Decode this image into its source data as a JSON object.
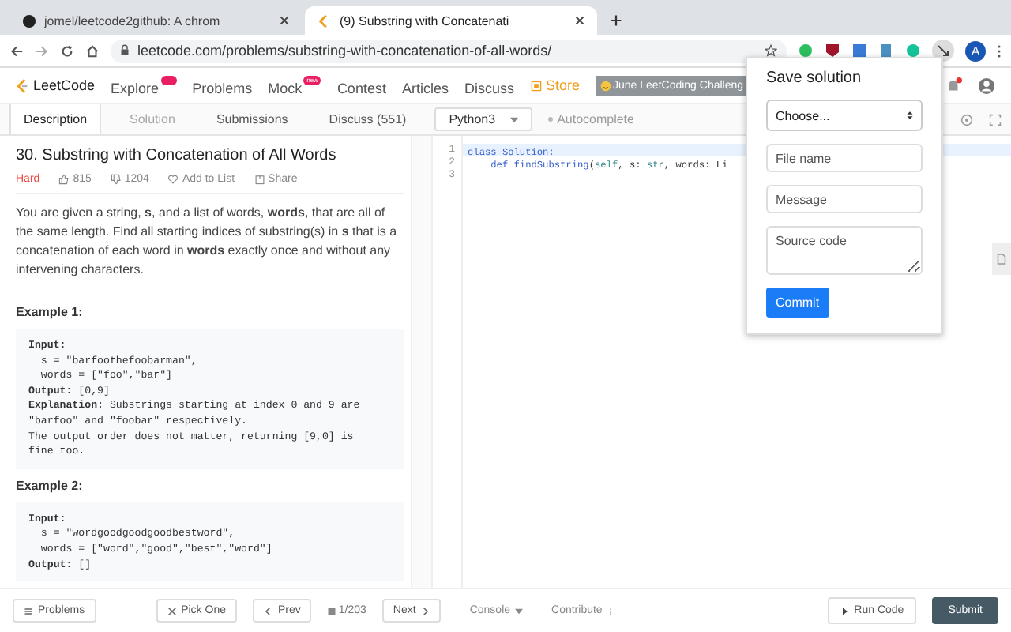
{
  "browser": {
    "tabs": [
      {
        "title": "jomel/leetcode2github: A chrom",
        "selected": false
      },
      {
        "title": "(9) Substring with Concatenati",
        "selected": true
      }
    ],
    "url": "leetcode.com/problems/substring-with-concatenation-of-all-words/",
    "profile": "A"
  },
  "nav": {
    "logo": "LeetCode",
    "items": [
      {
        "label": "Explore",
        "badge": true
      },
      {
        "label": "Problems",
        "badge": false
      },
      {
        "label": "Mock",
        "badge": true,
        "badge_text": "new"
      },
      {
        "label": "Contest",
        "badge": false
      },
      {
        "label": "Articles",
        "badge": false
      },
      {
        "label": "Discuss",
        "badge": false
      }
    ],
    "store": "Store",
    "banner": "June LeetCoding Challeng"
  },
  "subtabs": [
    {
      "label": "Description",
      "selected": true,
      "disabled": false
    },
    {
      "label": "Solution",
      "selected": false,
      "disabled": true
    },
    {
      "label": "Submissions",
      "selected": false,
      "disabled": false
    },
    {
      "label": "Discuss (551)",
      "selected": false,
      "disabled": false
    }
  ],
  "language": "Python3",
  "autocomplete": {
    "label": "Autocomplete",
    "on": false
  },
  "problem": {
    "title": "30. Substring with Concatenation of All Words",
    "difficulty": "Hard",
    "likes": "815",
    "dislikes": "1204",
    "add_to_list": "Add to List",
    "share": "Share",
    "description": "You are given a string, **s**, and a list of words, **words**, that are all of the same length. Find all starting indices of substring(s) in **s** that is a concatenation of each word in **words** exactly once and without any intervening characters.",
    "examples": [
      {
        "title": "Example 1:",
        "lines": [
          "**Input:**",
          "  s = \"barfoothefoobarman\",",
          "  words = [\"foo\",\"bar\"]",
          "**Output:** [0,9]",
          "**Explanation:** Substrings starting at index 0 and 9 are",
          "\"barfoo\" and \"foobar\" respectively.",
          "The output order does not matter, returning [9,0] is",
          "fine too."
        ]
      },
      {
        "title": "Example 2:",
        "lines": [
          "**Input:**",
          "  s = \"wordgoodgoodgoodbestword\",",
          "  words = [\"word\",\"good\",\"best\",\"word\"]",
          "**Output:** []"
        ]
      }
    ]
  },
  "editor": {
    "lines": [
      {
        "number": "1",
        "tokens": [
          {
            "text": "class ",
            "kind": "keyword"
          },
          {
            "text": "Solution:",
            "kind": "name"
          }
        ]
      },
      {
        "number": "2",
        "tokens": [
          {
            "text": "    def ",
            "kind": "keyword"
          },
          {
            "text": "findSubstring",
            "kind": "name"
          },
          {
            "text": "(",
            "kind": "plain"
          },
          {
            "text": "self",
            "kind": "builtin"
          },
          {
            "text": ", s: ",
            "kind": "plain"
          },
          {
            "text": "str",
            "kind": "builtin"
          },
          {
            "text": ", words: Li",
            "kind": "plain"
          }
        ]
      },
      {
        "number": "3"
      }
    ]
  },
  "popup": {
    "title": "Save solution",
    "select": "Choose...",
    "fields": [
      {
        "placeholder": "File name",
        "kind": "input"
      },
      {
        "placeholder": "Message",
        "kind": "input"
      },
      {
        "placeholder": "Source code",
        "kind": "textarea"
      }
    ],
    "button": "Commit"
  },
  "bottom": {
    "problems": "Problems",
    "pick_one": "Pick One",
    "prev": "Prev",
    "page": "1/203",
    "next": "Next",
    "console": "Console",
    "contribute": "Contribute",
    "run": "Run Code",
    "submit": "Submit"
  }
}
